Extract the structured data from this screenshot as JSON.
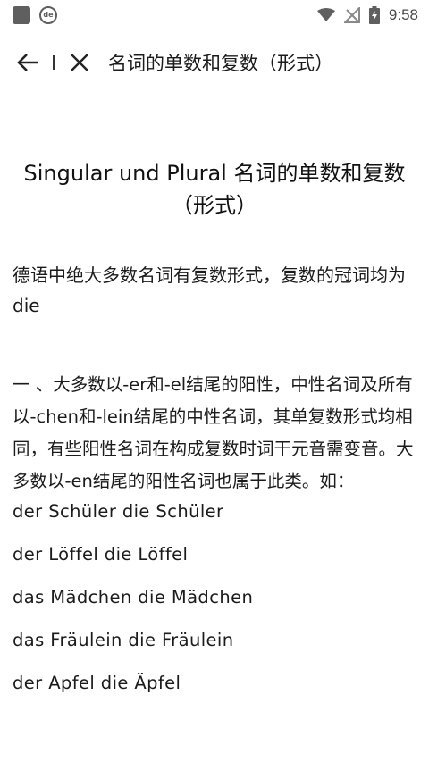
{
  "status_bar": {
    "de_badge": "de",
    "time": "9:58"
  },
  "toolbar": {
    "title": "名词的单数和复数（形式）"
  },
  "article": {
    "title_line1": "Singular und Plural 名词的单数和复数",
    "title_line2": "（形式）",
    "intro": "德语中绝大多数名词有复数形式，复数的冠词均为die",
    "section_text": "一 、大多数以-er和-el结尾的阳性，中性名词及所有以-chen和-lein结尾的中性名词，其单复数形式均相同，有些阳性名词在构成复数时词干元音需变音。大多数以-en结尾的阳性名词也属于此类。如：",
    "examples": [
      "der Schüler die Schüler",
      "der Löffel die Löffel",
      "das Mädchen die Mädchen",
      "das Fräulein die Fräulein",
      "der Apfel die Äpfel"
    ]
  }
}
